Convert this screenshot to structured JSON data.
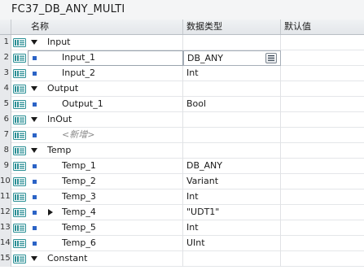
{
  "block_title": "FC37_DB_ANY_MULTI",
  "columns": {
    "name": "名称",
    "type": "数据类型",
    "default": "默认值"
  },
  "rows": [
    {
      "num": "1",
      "kind": "section",
      "name": "Input",
      "type": "",
      "default": ""
    },
    {
      "num": "2",
      "kind": "item",
      "name": "Input_1",
      "type": "DB_ANY",
      "default": "",
      "selected": true
    },
    {
      "num": "3",
      "kind": "item",
      "name": "Input_2",
      "type": "Int",
      "default": ""
    },
    {
      "num": "4",
      "kind": "section",
      "name": "Output",
      "type": "",
      "default": ""
    },
    {
      "num": "5",
      "kind": "item",
      "name": "Output_1",
      "type": "Bool",
      "default": ""
    },
    {
      "num": "6",
      "kind": "section",
      "name": "InOut",
      "type": "",
      "default": ""
    },
    {
      "num": "7",
      "kind": "add",
      "name": "<新增>",
      "type": "",
      "default": ""
    },
    {
      "num": "8",
      "kind": "section",
      "name": "Temp",
      "type": "",
      "default": ""
    },
    {
      "num": "9",
      "kind": "item",
      "name": "Temp_1",
      "type": "DB_ANY",
      "default": ""
    },
    {
      "num": "10",
      "kind": "item",
      "name": "Temp_2",
      "type": "Variant",
      "default": ""
    },
    {
      "num": "11",
      "kind": "item",
      "name": "Temp_3",
      "type": "Int",
      "default": ""
    },
    {
      "num": "12",
      "kind": "item",
      "name": "Temp_4",
      "type": "\"UDT1\"",
      "default": "",
      "expandable": true
    },
    {
      "num": "13",
      "kind": "item",
      "name": "Temp_5",
      "type": "Int",
      "default": ""
    },
    {
      "num": "14",
      "kind": "item",
      "name": "Temp_6",
      "type": "UInt",
      "default": ""
    },
    {
      "num": "15",
      "kind": "section",
      "name": "Constant",
      "type": "",
      "default": ""
    }
  ],
  "colors": {
    "accent": "#2b63c6",
    "icon_teal": "#2a8f95",
    "header_bg": "#e6e9ec",
    "rownum_bg": "#e7e9ec"
  },
  "icons": {
    "row": "interface-parameter-icon",
    "section_toggle": "triangle-down-icon",
    "collapsed_toggle": "triangle-right-icon",
    "dropdown": "datatype-list-icon"
  }
}
